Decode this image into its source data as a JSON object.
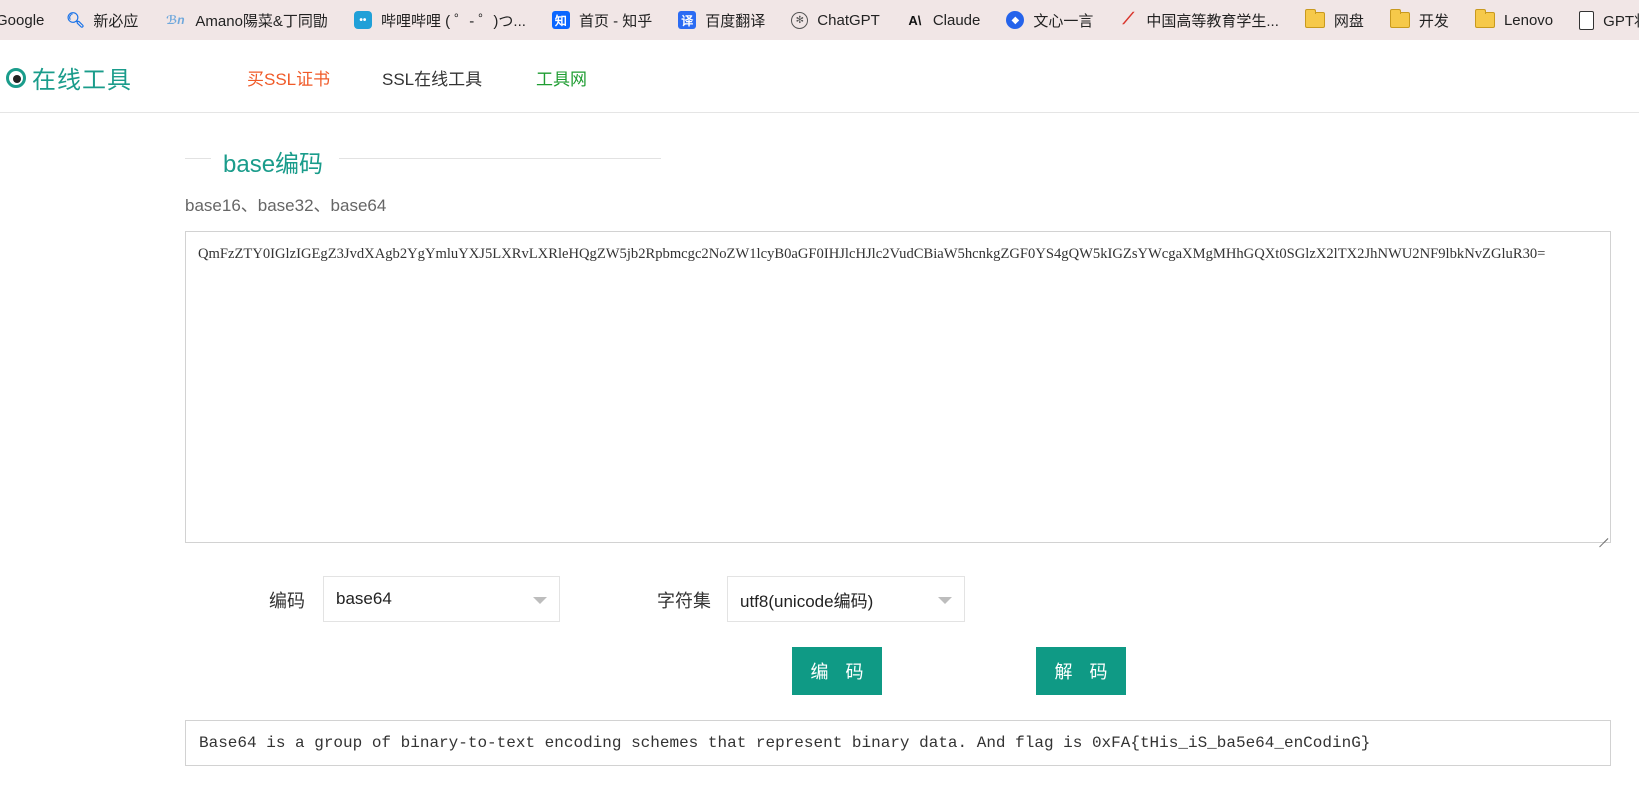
{
  "bookmarks": [
    {
      "label": "Google",
      "icon": "none"
    },
    {
      "label": "新必应",
      "icon": "search-icon"
    },
    {
      "label": "Amano陽菜&丁同勖",
      "icon": "amano-icon"
    },
    {
      "label": "哔哩哔哩 ( ゜- ゜)つ...",
      "icon": "bilibili-icon"
    },
    {
      "label": "首页 - 知乎",
      "icon": "zhihu-icon"
    },
    {
      "label": "百度翻译",
      "icon": "baidu-translate-icon"
    },
    {
      "label": "ChatGPT",
      "icon": "chatgpt-icon"
    },
    {
      "label": "Claude",
      "icon": "claude-icon"
    },
    {
      "label": "文心一言",
      "icon": "wenxin-icon"
    },
    {
      "label": "中国高等教育学生...",
      "icon": "chsi-icon"
    },
    {
      "label": "网盘",
      "icon": "folder-icon"
    },
    {
      "label": "开发",
      "icon": "folder-icon"
    },
    {
      "label": "Lenovo",
      "icon": "folder-icon"
    },
    {
      "label": "GPT状态",
      "icon": "page-icon"
    }
  ],
  "header": {
    "logo_text": "在线工具",
    "nav": {
      "buy_ssl": "买SSL证书",
      "ssl_tools": "SSL在线工具",
      "tool_net": "工具网"
    }
  },
  "section": {
    "title": "base编码",
    "subtitle": "base16、base32、base64"
  },
  "input": {
    "value": "QmFzZTY0IGlzIGEgZ3JvdXAgb2YgYmluYXJ5LXRvLXRleHQgZW5jb2Rpbmcgc2NoZW1lcyB0aGF0IHJlcHJlc2VudCBiaW5hcnkgZGF0YS4gQW5kIGZsYWcgaXMgMHhGQXt0SGlzX2lTX2JhNWU2NF9lbkNvZGluR30="
  },
  "controls": {
    "encoding_label": "编码",
    "encoding_value": "base64",
    "charset_label": "字符集",
    "charset_value": "utf8(unicode编码)",
    "encode_button": "编 码",
    "decode_button": "解 码"
  },
  "output": {
    "value": "Base64 is a group of binary-to-text encoding schemes that represent binary data. And flag is 0xFA{tHis_iS_ba5e64_enCodinG}"
  },
  "colors": {
    "brand_teal": "#1a9c8b",
    "button": "#0f9a85",
    "nav_orange": "#f05a28",
    "nav_green": "#1f9d32"
  }
}
